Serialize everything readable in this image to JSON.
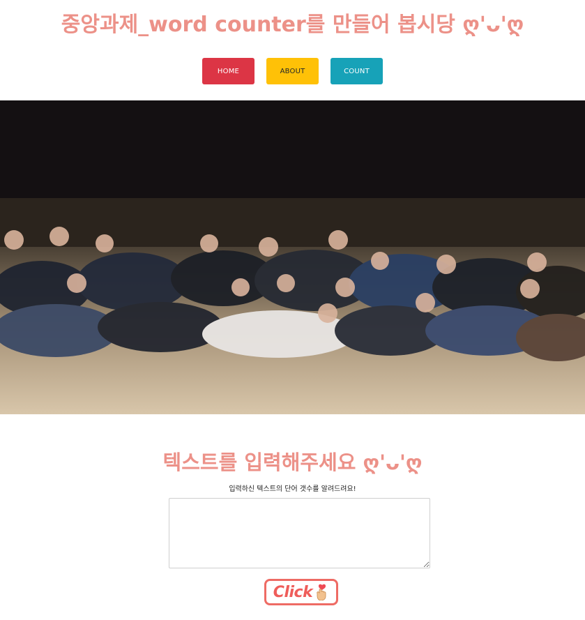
{
  "header": {
    "title": "중앙과제_word counter를 만들어 봅시당 ღ'ᴗ'ღ"
  },
  "nav": {
    "home": "HOME",
    "about": "ABOUT",
    "count": "COUNT"
  },
  "colors": {
    "title": "#ec9188",
    "home": "#dc3545",
    "about": "#ffc107",
    "count": "#17a2b8",
    "click_border": "#ee6b64"
  },
  "counter": {
    "title": "텍스트를 입력해주세요 ღ'ᴗ'ღ",
    "subtitle": "입력하신 텍스트의 단어 갯수를 알려드려요!",
    "input_value": "",
    "button_label": "Click"
  },
  "icons": {
    "button_icon": "hand-heart-icon"
  }
}
